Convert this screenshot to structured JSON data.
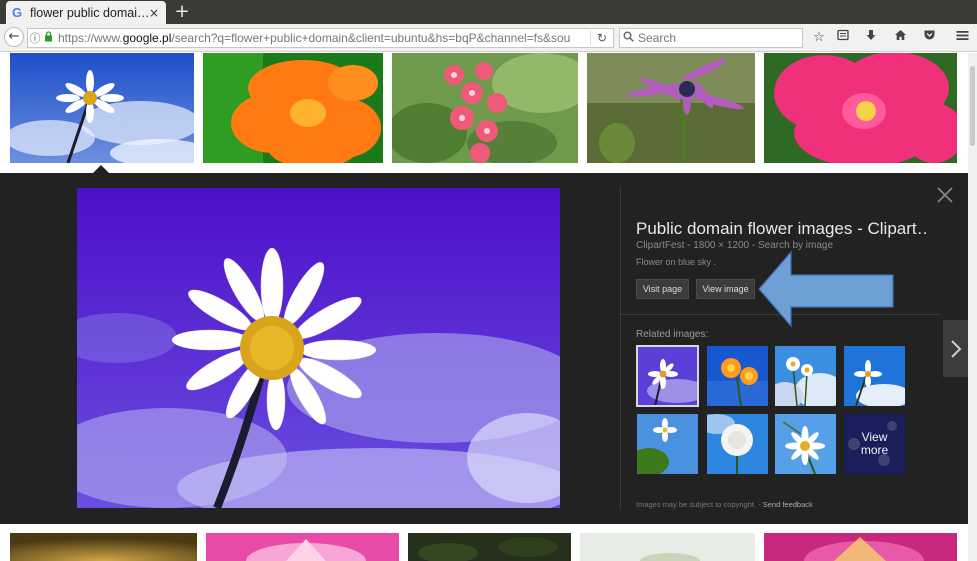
{
  "browser": {
    "tab_title": "flower public domai…",
    "tab_close": "×",
    "new_tab": "+",
    "url_prefix": "https://www.",
    "url_domain": "google.pl",
    "url_rest": "/search?q=flower+public+domain&client=ubuntu&hs=bqP&channel=fs&sou",
    "search_placeholder": "Search"
  },
  "preview": {
    "title": "Public domain flower images - Clipart…",
    "meta": "ClipartFest - 1800 × 1200 - Search by image",
    "description": "Flower on blue sky .",
    "visit_page_label": "Visit page",
    "view_image_label": "View image",
    "related_heading": "Related images:",
    "view_more_label": "View more",
    "footnote_text": "Images may be subject to copyright. - ",
    "send_feedback_label": "Send feedback"
  },
  "colors": {
    "panel_bg": "#222222",
    "arrow_fill": "#6e9fd5",
    "big_image_bg": "#4d16c8"
  },
  "icons": [
    "google-g-icon",
    "close-icon",
    "plus-icon",
    "back-arrow-icon",
    "info-icon",
    "lock-icon",
    "reload-icon",
    "search-icon",
    "star-icon",
    "reading-list-icon",
    "download-icon",
    "home-icon",
    "pocket-icon",
    "menu-icon",
    "chevron-right-icon",
    "arrow-annotation"
  ]
}
